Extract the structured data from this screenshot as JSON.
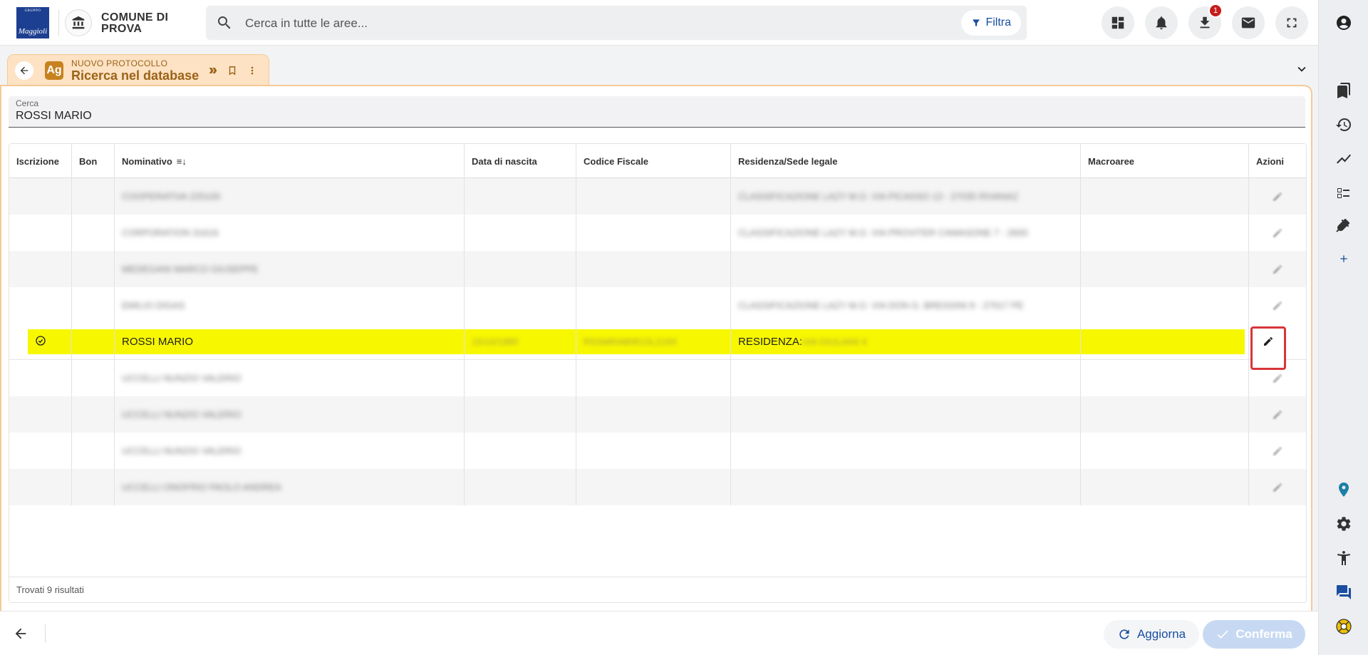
{
  "header": {
    "logo_small": "GRUPPO",
    "logo_main": "Maggioli",
    "town_name": "COMUNE DI PROVA",
    "search_placeholder": "Cerca in tutte le aree...",
    "filter_label": "Filtra",
    "download_badge": "1"
  },
  "tab": {
    "icon_letters": "Ag",
    "subtitle": "NUOVO PROTOCOLLO",
    "title": "Ricerca nel database"
  },
  "search_field": {
    "label": "Cerca",
    "value": "ROSSI MARIO"
  },
  "table": {
    "columns": [
      "Iscrizione",
      "Bon",
      "Nominativo",
      "Data di nascita",
      "Codice Fiscale",
      "Residenza/Sede legale",
      "Macroaree",
      "Azioni"
    ],
    "sort_indicator": "≡↓",
    "rows": [
      {
        "nominativo": "COOPERATIVA 225100",
        "data": "",
        "cf": "",
        "residenza": "CLASSIFICAZIONE LAZY M.O. VIA PICASSO 13 - 27035 RIVANAZ"
      },
      {
        "nominativo": "CORPORATION 31616",
        "data": "",
        "cf": "",
        "residenza": "CLASSIFICAZIONE LAZY M.O. VIA PROVITER CAMASONE 7 - 2600"
      },
      {
        "nominativo": "MEDEGANI MARCO GIUSEPPE",
        "data": "",
        "cf": "",
        "residenza": ""
      },
      {
        "nominativo": "EMILIO DIGAS",
        "data": "",
        "cf": "",
        "residenza": "CLASSIFICAZIONE LAZY M.O. VIA DON G. BRESSINI 8 - 27017 PE"
      },
      {
        "nominativo": "ROSSI MARIO",
        "data": "15/10/1980",
        "cf": "RSSMRA80R15L219X",
        "residenza_prefix": "RESIDENZA:",
        "residenza": "VIA GIULIANI 4",
        "selected": true
      },
      {
        "nominativo": "UCCELLI NUNZIO VALERIO",
        "data": "",
        "cf": "",
        "residenza": ""
      },
      {
        "nominativo": "UCCELLI NUNZIO VALERIO",
        "data": "",
        "cf": "",
        "residenza": ""
      },
      {
        "nominativo": "UCCELLI NUNZIO VALERIO",
        "data": "",
        "cf": "",
        "residenza": ""
      },
      {
        "nominativo": "UCCELLI ONOFRIO PAOLO ANDREA",
        "data": "",
        "cf": "",
        "residenza": ""
      }
    ],
    "result_count": "Trovati 9 risultati"
  },
  "footer": {
    "refresh_label": "Aggiorna",
    "confirm_label": "Conferma"
  },
  "colors": {
    "accent_blue": "#1a4ea0",
    "tab_bg": "#fde2c4",
    "selection_yellow": "#f7f700",
    "highlight_red": "#d8353a"
  }
}
